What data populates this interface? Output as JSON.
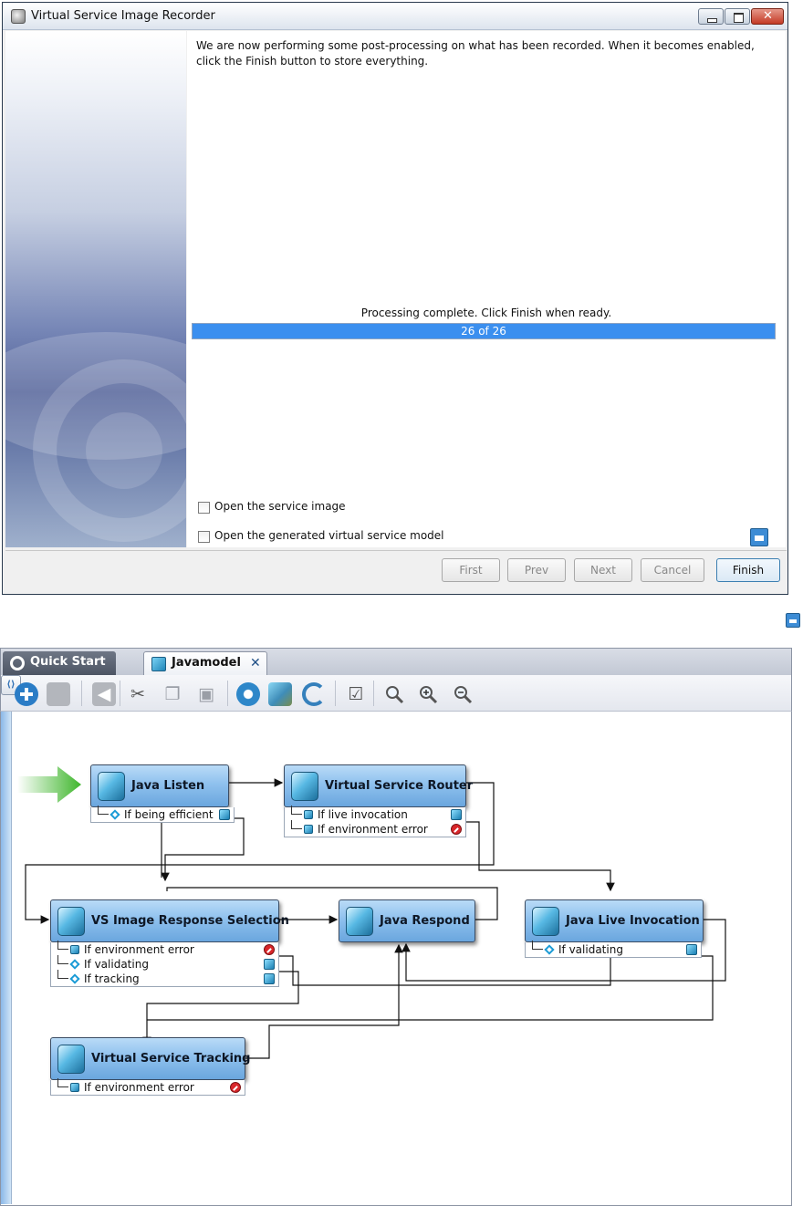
{
  "dialog": {
    "title": "Virtual Service Image Recorder",
    "message": "We are now performing some post-processing on what has been recorded.  When it becomes enabled, click the Finish button to store everything.",
    "status": "Processing complete.  Click Finish when ready.",
    "progress": {
      "label": "26 of 26",
      "current": 26,
      "total": 26
    },
    "checkboxes": [
      {
        "label": "Open the service image",
        "checked": false
      },
      {
        "label": "Open the generated virtual service model",
        "checked": false
      }
    ],
    "buttons": {
      "first": "First",
      "prev": "Prev",
      "next": "Next",
      "cancel": "Cancel",
      "finish": "Finish"
    }
  },
  "editor": {
    "tabs": [
      {
        "label": "Quick Start",
        "active": false
      },
      {
        "label": "Javamodel",
        "active": true,
        "close": "✕"
      }
    ],
    "toolbar_right": "⟨⟩",
    "nodes": {
      "java_listen": {
        "title": "Java Listen",
        "branches": [
          "If being efficient"
        ]
      },
      "router": {
        "title": "Virtual Service Router",
        "branches": [
          "If live invocation",
          "If environment error"
        ]
      },
      "vs_selection": {
        "title": "VS Image Response Selection",
        "branches": [
          "If environment error",
          "If validating",
          "If tracking"
        ]
      },
      "java_respond": {
        "title": "Java Respond",
        "branches": []
      },
      "live_invocation": {
        "title": "Java Live Invocation",
        "branches": [
          "If validating"
        ]
      },
      "tracking": {
        "title": "Virtual Service Tracking",
        "branches": [
          "If environment error"
        ]
      }
    }
  },
  "colors": {
    "progress": "#3b8fef",
    "node_header": "#8fc1ee",
    "start_arrow": "#3fb62c",
    "stop": "#d9262a"
  }
}
